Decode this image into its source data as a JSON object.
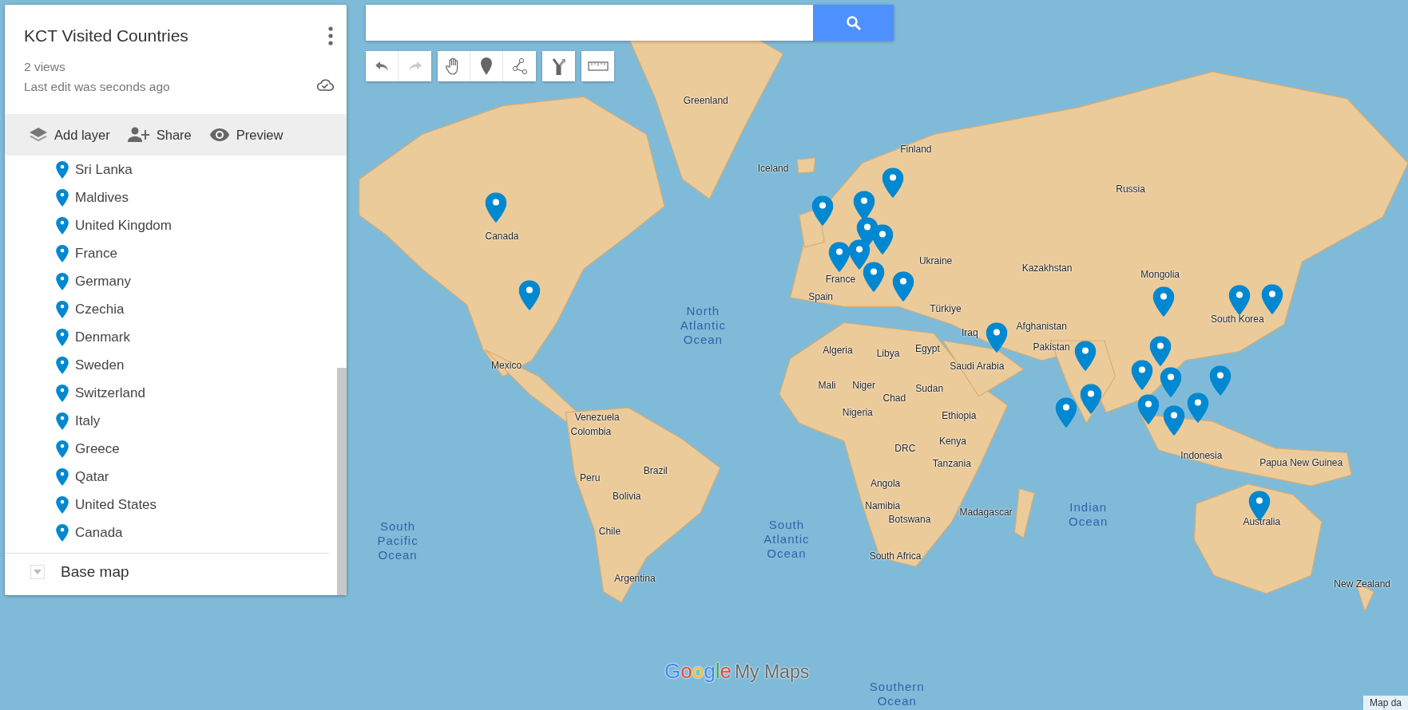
{
  "map_title": "KCT Visited Countries",
  "views": "2 views",
  "last_edit": "Last edit was seconds ago",
  "actions": [
    {
      "kind": "layer",
      "label": "Add layer"
    },
    {
      "kind": "share",
      "label": "Share"
    },
    {
      "kind": "preview",
      "label": "Preview"
    }
  ],
  "places": [
    "Sri Lanka",
    "Maldives",
    "United Kingdom",
    "France",
    "Germany",
    "Czechia",
    "Denmark",
    "Sweden",
    "Switzerland",
    "Italy",
    "Greece",
    "Qatar",
    "United States",
    "Canada"
  ],
  "base_map": {
    "label": "Base map",
    "expanded": false
  },
  "map_labels": [
    {
      "kind": "country",
      "text": "Greenland"
    },
    {
      "kind": "country",
      "text": "Iceland"
    },
    {
      "kind": "country",
      "text": "Finland"
    },
    {
      "kind": "country",
      "text": "Russia"
    },
    {
      "kind": "country",
      "text": "Canada"
    },
    {
      "kind": "country",
      "text": "Kazakhstan"
    },
    {
      "kind": "country",
      "text": "Ukraine"
    },
    {
      "kind": "country",
      "text": "Mongolia"
    },
    {
      "kind": "country",
      "text": "Spain"
    },
    {
      "kind": "country",
      "text": "Türkiye"
    },
    {
      "kind": "country",
      "text": "Afghanistan"
    },
    {
      "kind": "ocean",
      "text": "North Atlantic Ocean"
    },
    {
      "kind": "country",
      "text": "Pakistan"
    },
    {
      "kind": "country",
      "text": "Iraq"
    },
    {
      "kind": "country",
      "text": "Algeria"
    },
    {
      "kind": "country",
      "text": "Libya"
    },
    {
      "kind": "country",
      "text": "Egypt"
    },
    {
      "kind": "country",
      "text": "Saudi Arabia"
    },
    {
      "kind": "country",
      "text": "Mexico"
    },
    {
      "kind": "country",
      "text": "Mali"
    },
    {
      "kind": "country",
      "text": "Niger"
    },
    {
      "kind": "country",
      "text": "Chad"
    },
    {
      "kind": "country",
      "text": "Sudan"
    },
    {
      "kind": "country",
      "text": "Venezuela"
    },
    {
      "kind": "country",
      "text": "Nigeria"
    },
    {
      "kind": "country",
      "text": "Ethiopia"
    },
    {
      "kind": "country",
      "text": "Colombia"
    },
    {
      "kind": "country",
      "text": "Kenya"
    },
    {
      "kind": "country",
      "text": "DRC"
    },
    {
      "kind": "country",
      "text": "Tanzania"
    },
    {
      "kind": "country",
      "text": "Indonesia"
    },
    {
      "kind": "country",
      "text": "Papua New Guinea"
    },
    {
      "kind": "country",
      "text": "Brazil"
    },
    {
      "kind": "country",
      "text": "Peru"
    },
    {
      "kind": "country",
      "text": "Bolivia"
    },
    {
      "kind": "country",
      "text": "Angola"
    },
    {
      "kind": "country",
      "text": "Namibia"
    },
    {
      "kind": "country",
      "text": "Madagascar"
    },
    {
      "kind": "country",
      "text": "Botswana"
    },
    {
      "kind": "country",
      "text": "Chile"
    },
    {
      "kind": "country",
      "text": "South Africa"
    },
    {
      "kind": "country",
      "text": "Argentina"
    },
    {
      "kind": "country",
      "text": "Australia"
    },
    {
      "kind": "country",
      "text": "New Zealand"
    },
    {
      "kind": "ocean",
      "text": "South Pacific Ocean"
    },
    {
      "kind": "ocean",
      "text": "South Atlantic Ocean"
    },
    {
      "kind": "ocean",
      "text": "Indian Ocean"
    },
    {
      "kind": "ocean",
      "text": "Southern Ocean"
    },
    {
      "kind": "country",
      "text": "France"
    },
    {
      "kind": "country",
      "text": "South Korea"
    }
  ],
  "logo": {
    "brand": "Google",
    "product": "My Maps"
  },
  "attribution": "Map da"
}
